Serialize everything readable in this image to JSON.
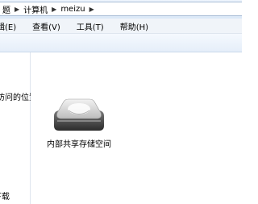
{
  "address_bar": {
    "crumbs": [
      "题",
      "计算机",
      "meizu"
    ],
    "separator": "▶"
  },
  "menu": {
    "items": [
      "辑(E)",
      "查看(V)",
      "工具(T)",
      "帮助(H)"
    ]
  },
  "nav": {
    "recent_label": "近访问的位置",
    "downloads_label": "下载"
  },
  "content": {
    "drive_label": "内部共享存储空间",
    "drive_icon": "removable-drive-icon"
  },
  "colors": {
    "toolbar_bg": "#e5eef9",
    "window_bg": "#ffffff"
  }
}
